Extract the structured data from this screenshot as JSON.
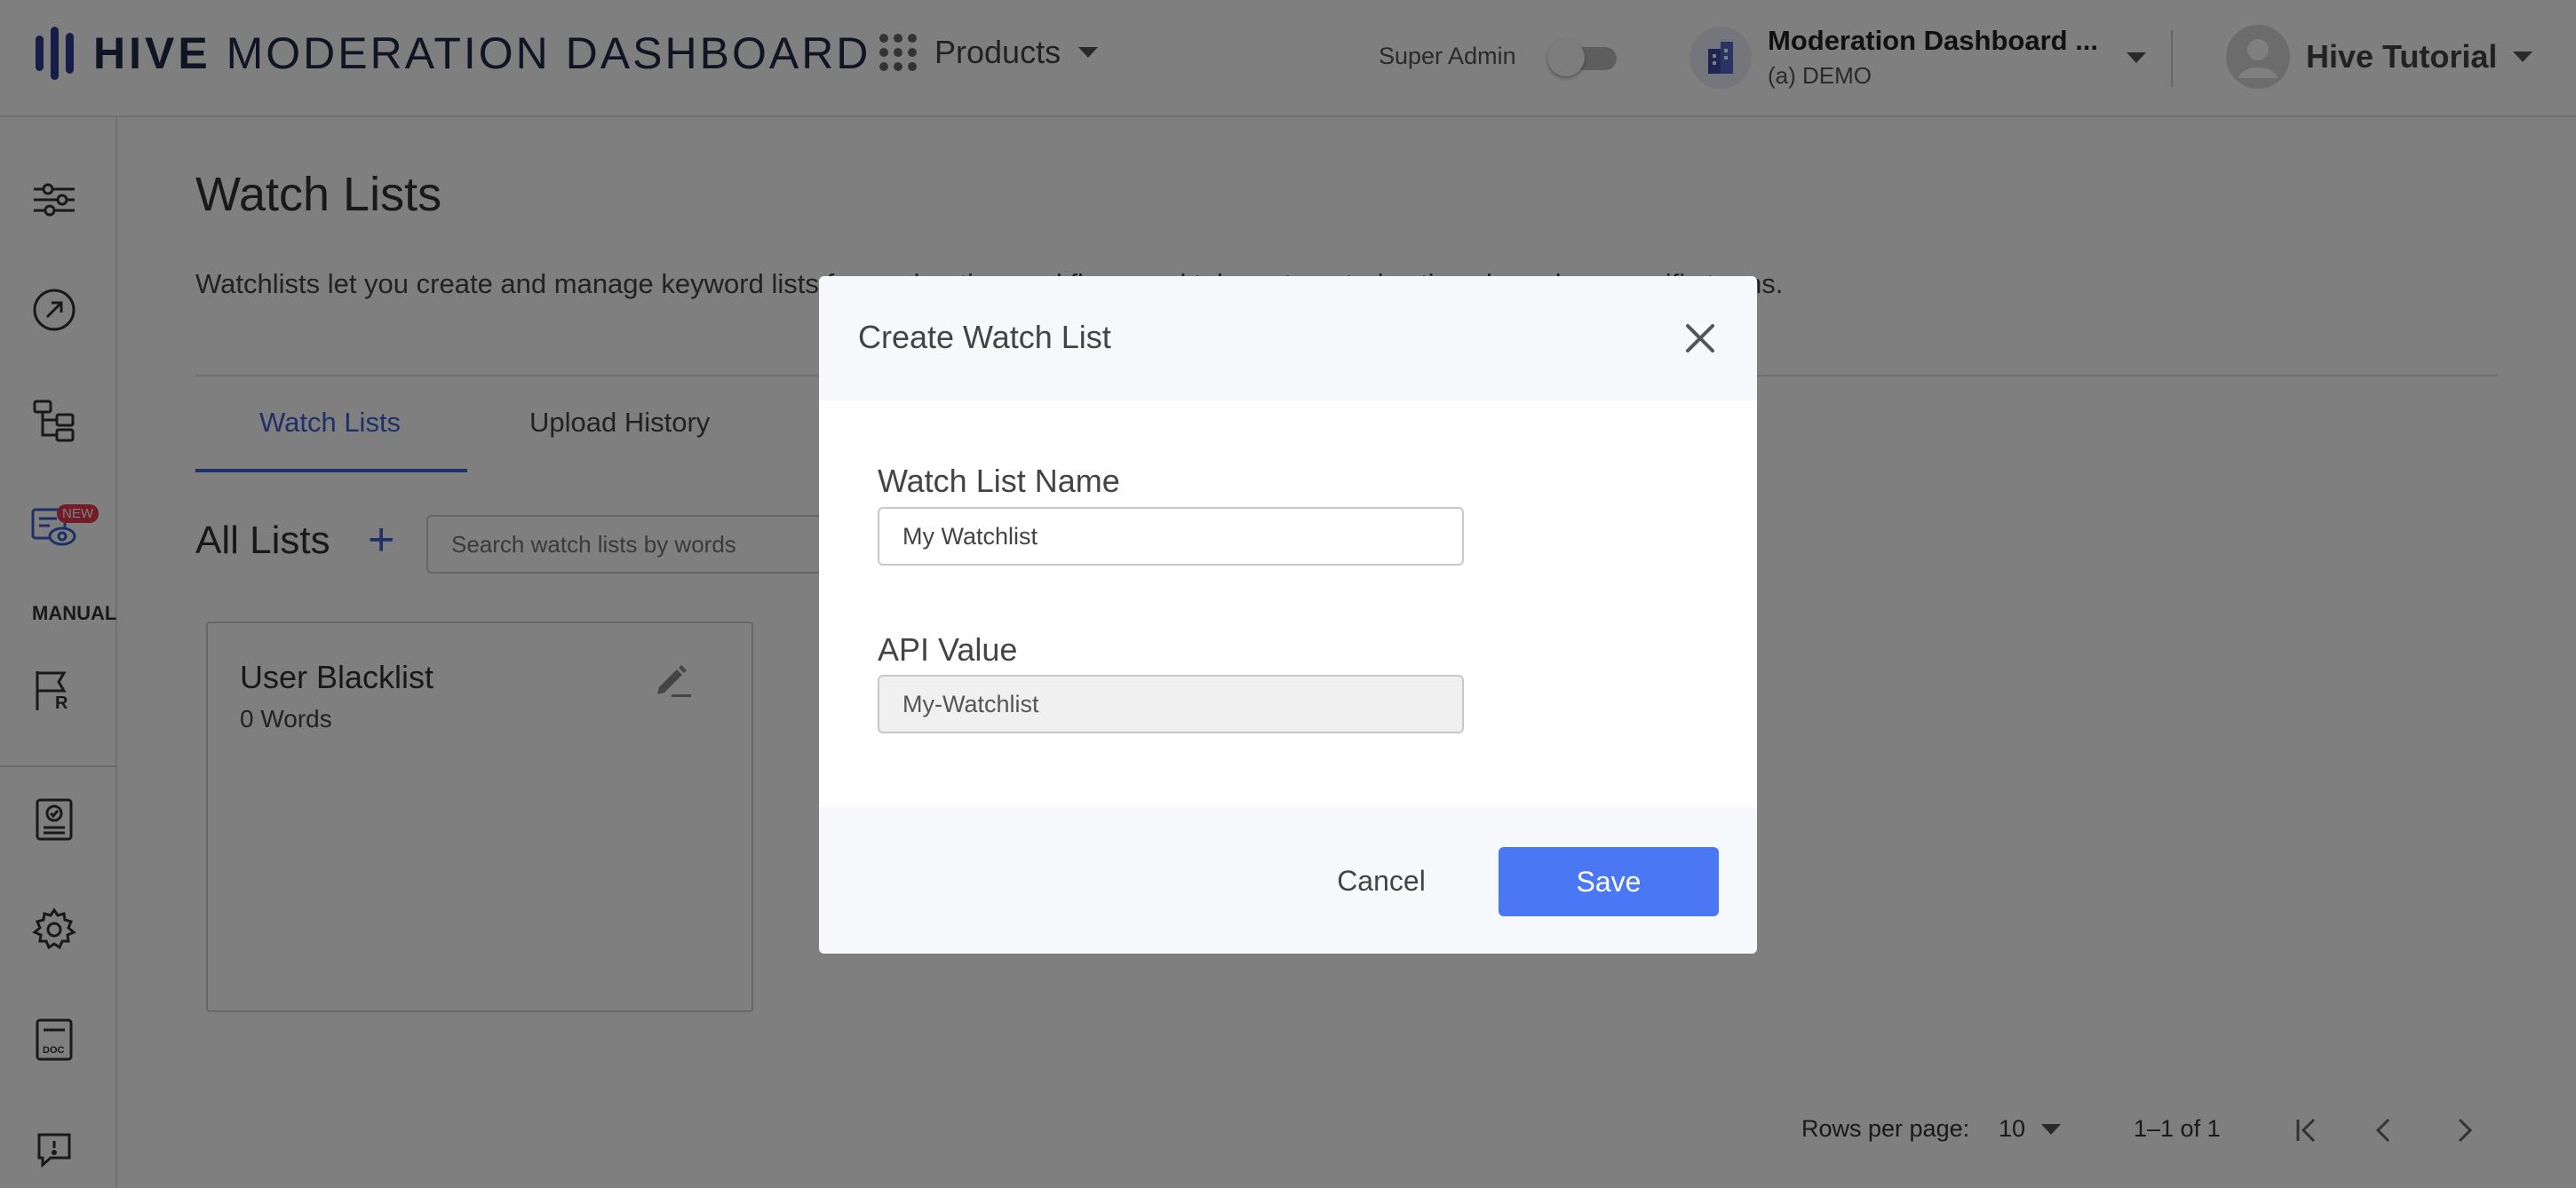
{
  "header": {
    "logo_bold": "HIVE",
    "logo_rest": "MODERATION DASHBOARD",
    "products_label": "Products",
    "super_admin_label": "Super Admin",
    "org_name": "Moderation Dashboard ...",
    "org_sub": "(a) DEMO",
    "user_name": "Hive Tutorial"
  },
  "sidebar": {
    "icons": [
      "sliders-icon",
      "arrow-circle-icon",
      "flow-icon",
      "watchlist-icon",
      "flag-r-icon",
      "report-icon",
      "gear-icon",
      "doc-icon",
      "feedback-icon"
    ],
    "new_badge": "NEW",
    "manual_label": "MANUAL"
  },
  "main": {
    "title": "Watch Lists",
    "description": "Watchlists let you create and manage keyword lists for moderation workflows and take automated actions based on specific terms.",
    "tabs": [
      {
        "label": "Watch Lists",
        "active": true
      },
      {
        "label": "Upload History",
        "active": false
      }
    ],
    "all_lists_label": "All Lists",
    "search_placeholder": "Search watch lists by words",
    "cards": [
      {
        "title": "User Blacklist",
        "subtitle": "0 Words"
      }
    ],
    "pagination": {
      "rows_per_page_label": "Rows per page:",
      "rows_per_page_value": "10",
      "range": "1–1 of 1"
    }
  },
  "modal": {
    "title": "Create Watch List",
    "name_label": "Watch List Name",
    "name_value": "My Watchlist",
    "api_label": "API Value",
    "api_value": "My-Watchlist",
    "cancel_label": "Cancel",
    "save_label": "Save"
  },
  "colors": {
    "accent": "#3f5fd0",
    "save_button": "#4a78f5",
    "badge": "#e63950",
    "overlay": "rgba(0,0,0,0.5)"
  }
}
